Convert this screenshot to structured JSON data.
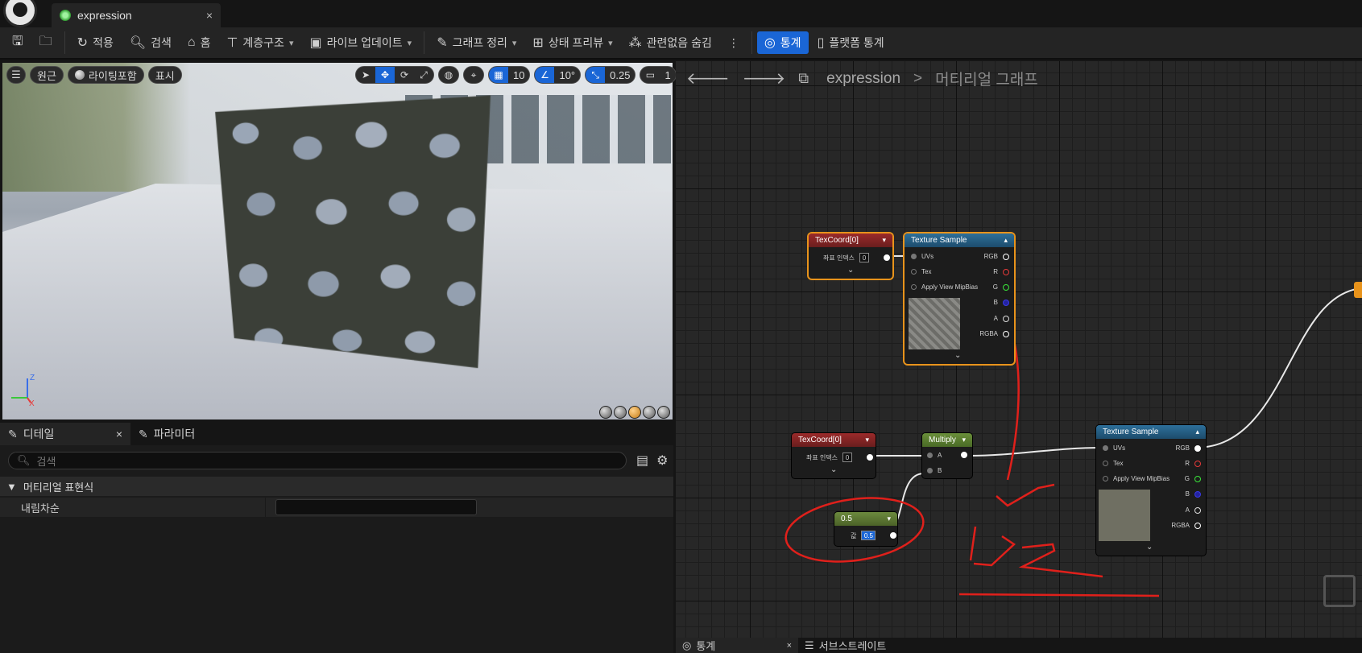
{
  "titlebar": {
    "tab_label": "expression",
    "close": "×"
  },
  "toolbar": {
    "apply": "적용",
    "search": "검색",
    "home": "홈",
    "hierarchy": "계층구조",
    "live_update": "라이브 업데이트",
    "clean_graph": "그래프 정리",
    "preview_state": "상태 프리뷰",
    "hide_unrelated": "관련없음 숨김",
    "more": "⋮",
    "stats": "통계",
    "platform_stats": "플랫폼 통계"
  },
  "viewport": {
    "perspective": "원근",
    "lighting": "라이팅포함",
    "show": "표시",
    "grid_value": "10",
    "angle_value": "10°",
    "scale_value": "0.25",
    "camera_value": "1",
    "axis_z": "Z",
    "axis_x": "X"
  },
  "details": {
    "tab_details": "디테일",
    "tab_params": "파라미터",
    "search_placeholder": "검색",
    "category": "머티리얼 표현식",
    "row_label": "내림차순"
  },
  "graph": {
    "breadcrumb_root": "expression",
    "breadcrumb_sep": ">",
    "breadcrumb_current": "머티리얼 그래프",
    "nodes": {
      "texcoord_a": {
        "title": "TexCoord[0]",
        "param": "좌표 인덱스",
        "value": "0"
      },
      "texsample_a": {
        "title": "Texture Sample",
        "uvs": "UVs",
        "tex": "Tex",
        "mip": "Apply View MipBias",
        "out_rgb": "RGB",
        "out_r": "R",
        "out_g": "G",
        "out_b": "B",
        "out_a": "A",
        "out_rgba": "RGBA"
      },
      "texcoord_b": {
        "title": "TexCoord[0]",
        "param": "좌표 인덱스",
        "value": "0"
      },
      "multiply": {
        "title": "Multiply",
        "in_a": "A",
        "in_b": "B"
      },
      "constant": {
        "title": "0.5",
        "label": "값",
        "value": "0.5"
      },
      "texsample_b": {
        "title": "Texture Sample",
        "uvs": "UVs",
        "tex": "Tex",
        "mip": "Apply View MipBias",
        "out_rgb": "RGB",
        "out_r": "R",
        "out_g": "G",
        "out_b": "B",
        "out_a": "A",
        "out_rgba": "RGBA"
      }
    }
  },
  "bottom": {
    "tab_stats": "통계",
    "tab_substrate": "서브스트레이트"
  },
  "colors": {
    "accent": "#1a66d6",
    "selection": "#e8931b",
    "annotation": "#e0201b"
  }
}
